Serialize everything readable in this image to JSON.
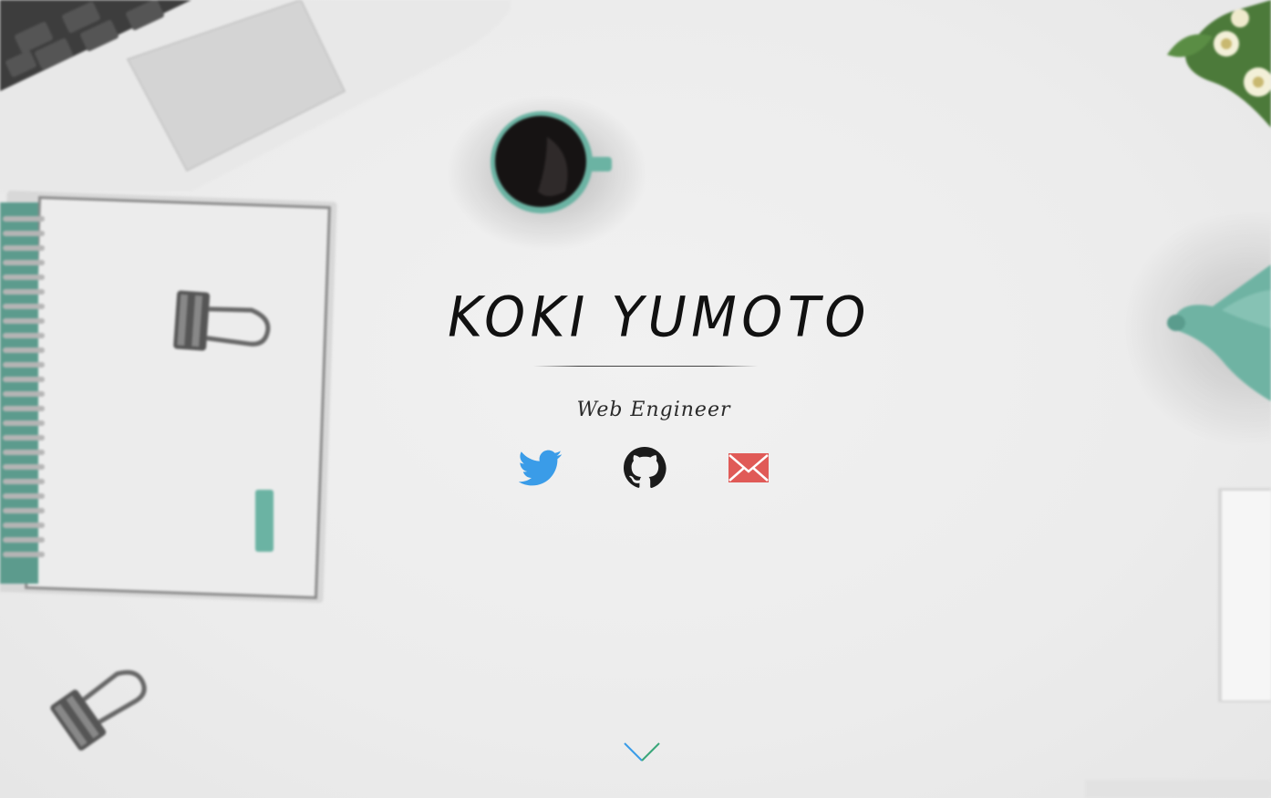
{
  "hero": {
    "name": "KOKI YUMOTO",
    "role": "Web Engineer"
  },
  "social": [
    {
      "icon": "twitter-bird-icon",
      "color": "#3a9ce8"
    },
    {
      "icon": "github-octocat-icon",
      "color": "#1b1b1b"
    },
    {
      "icon": "mail-envelope-icon",
      "color": "#e05a57"
    }
  ],
  "scroll": {
    "icon": "chevron-down-icon",
    "colors": [
      "#3a9ce8",
      "#3aa67a"
    ]
  },
  "background": {
    "description_free": true,
    "accent": "#6bb3a3"
  }
}
